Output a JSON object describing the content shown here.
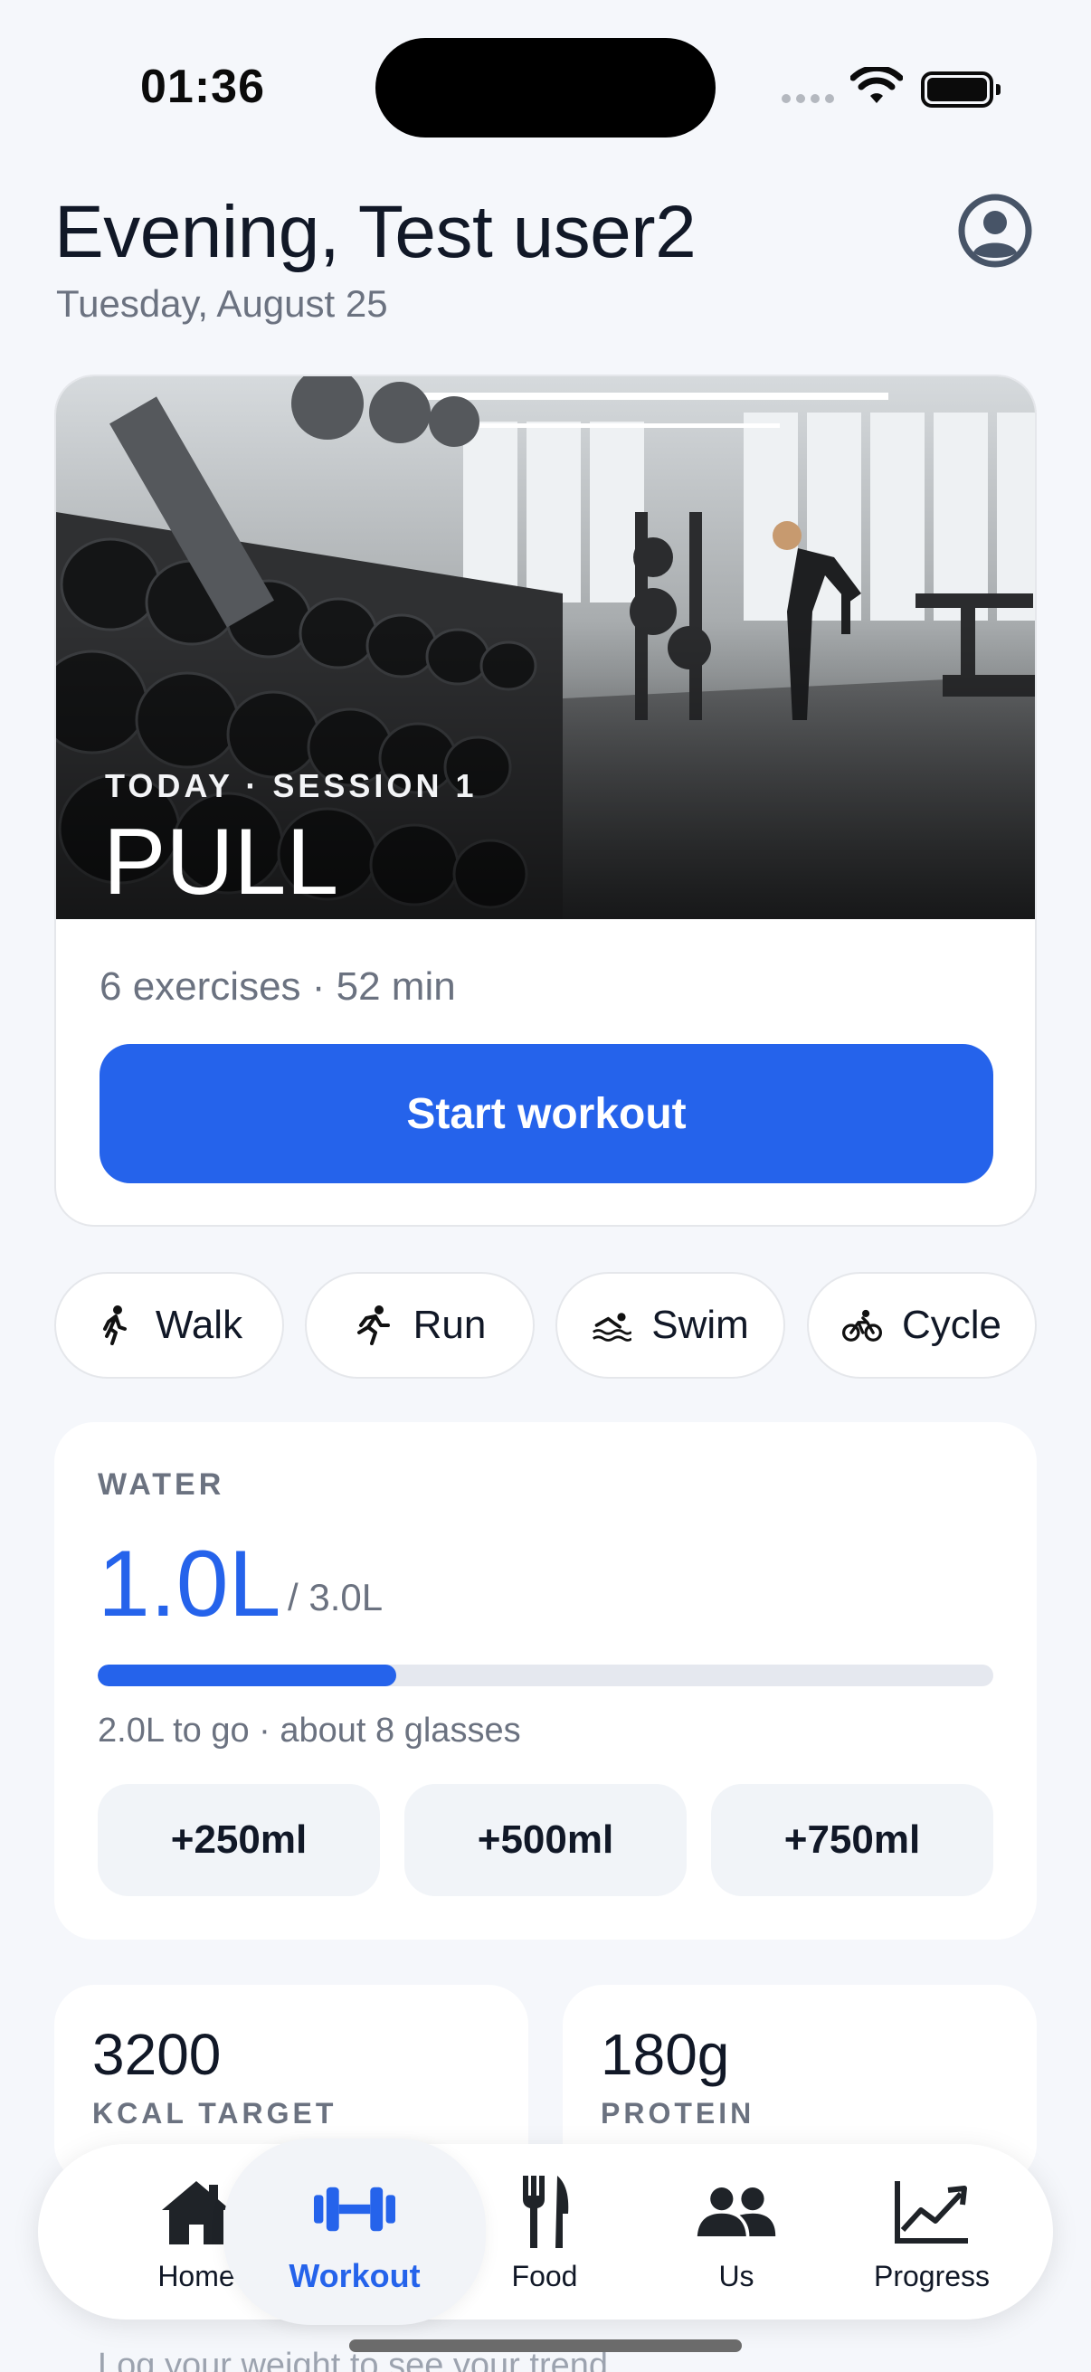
{
  "status_bar": {
    "time": "01:36"
  },
  "header": {
    "greeting": "Evening, Test user2",
    "date": "Tuesday, August 25",
    "profile_icon": "user-circle-icon"
  },
  "workout_card": {
    "session_label": "TODAY · SESSION 1",
    "title": "PULL",
    "meta": "6 exercises · 52 min",
    "start_label": "Start workout",
    "accent": "#2563eb"
  },
  "activities": [
    {
      "label": "Walk",
      "icon": "walk-icon"
    },
    {
      "label": "Run",
      "icon": "run-icon"
    },
    {
      "label": "Swim",
      "icon": "swim-icon"
    },
    {
      "label": "Cycle",
      "icon": "cycle-icon"
    }
  ],
  "water": {
    "label": "WATER",
    "amount": "1.0L",
    "goal": "/ 3.0L",
    "progress_fraction": 0.333,
    "note": "2.0L to go · about 8 glasses",
    "buttons": [
      "+250ml",
      "+500ml",
      "+750ml"
    ]
  },
  "stats": [
    {
      "value": "3200",
      "label": "KCAL TARGET"
    },
    {
      "value": "180g",
      "label": "PROTEIN"
    }
  ],
  "hint_text": "Log your weight to see your trend",
  "tabs": [
    {
      "label": "Home",
      "icon": "home-icon",
      "active": false
    },
    {
      "label": "Workout",
      "icon": "dumbbell-icon",
      "active": true
    },
    {
      "label": "Food",
      "icon": "fork-knife-icon",
      "active": false
    },
    {
      "label": "Us",
      "icon": "people-icon",
      "active": false
    },
    {
      "label": "Progress",
      "icon": "chart-trend-icon",
      "active": false
    }
  ]
}
